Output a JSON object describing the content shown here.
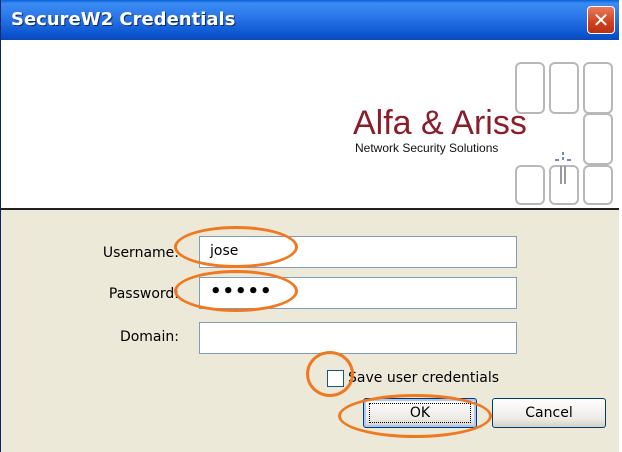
{
  "window": {
    "title": "SecureW2 Credentials",
    "close_symbol": "✕"
  },
  "banner": {
    "logo_text": "Alfa & Ariss",
    "logo_subtitle": "Network Security Solutions",
    "logo_color": "#8b1c2a"
  },
  "form": {
    "username_label": "Username:",
    "username_value": "jose",
    "password_label": "Password:",
    "password_value": "•••••",
    "domain_label": "Domain:",
    "domain_value": "",
    "save_checkbox_label": "Save user credentials",
    "save_checkbox_checked": false
  },
  "buttons": {
    "ok_label": "OK",
    "cancel_label": "Cancel"
  },
  "annotations": {
    "highlight_color": "#f07820"
  },
  "colors": {
    "titlebar": "#2a74e6",
    "dialog_bg": "#ece9d8",
    "close_button": "#d0401c"
  }
}
